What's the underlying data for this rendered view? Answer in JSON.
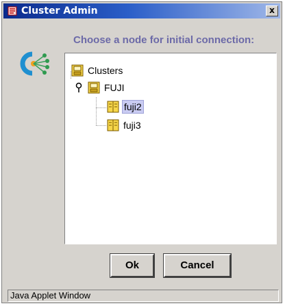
{
  "window": {
    "title": "Cluster Admin",
    "close_label": "x"
  },
  "dialog": {
    "heading": "Choose a node for initial connection:"
  },
  "tree": {
    "root": {
      "label": "Clusters",
      "icon": "cluster-folder-icon"
    },
    "cluster": {
      "label": "FUJI",
      "icon": "cluster-folder-icon",
      "expanded": true
    },
    "nodes": [
      {
        "label": "fuji2",
        "icon": "server-node-icon",
        "selected": true
      },
      {
        "label": "fuji3",
        "icon": "server-node-icon",
        "selected": false
      }
    ]
  },
  "buttons": {
    "ok": "Ok",
    "cancel": "Cancel"
  },
  "status": {
    "text": "Java Applet Window"
  },
  "colors": {
    "heading": "#6c6aa8",
    "selection": "#c9cbf2",
    "titlebar": "#0a2a8c"
  }
}
